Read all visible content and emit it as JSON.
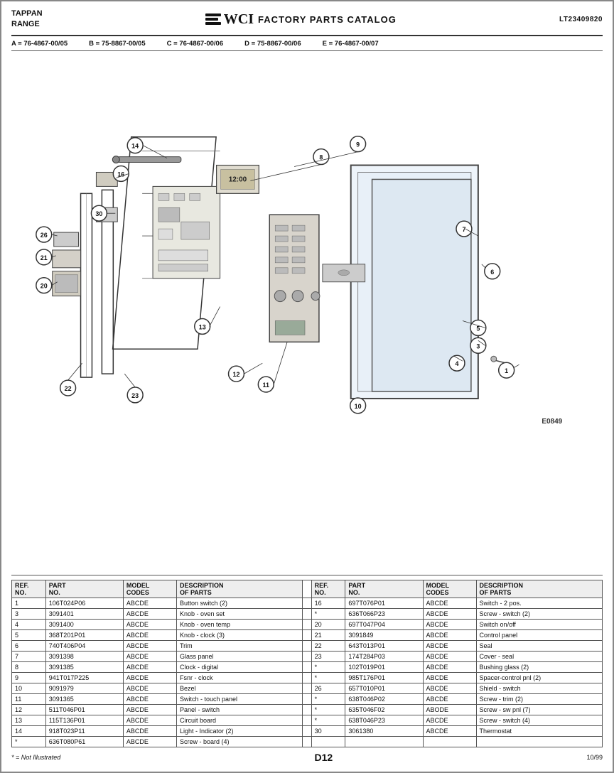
{
  "header": {
    "brand": "TAPPAN\nRANGE",
    "catalog": "FACTORY PARTS CATALOG",
    "catalog_number": "LT23409820"
  },
  "model_codes": [
    "A = 76-4867-00/05",
    "B = 75-8867-00/05",
    "C = 76-4867-00/06",
    "D = 75-8867-00/06",
    "E = 76-4867-00/07"
  ],
  "diagram_id": "E0849",
  "parts_left": [
    {
      "ref": "1",
      "part": "106T024P06",
      "model": "ABCDE",
      "desc": "Button switch (2)"
    },
    {
      "ref": "3",
      "part": "3091401",
      "model": "ABCDE",
      "desc": "Knob - oven set"
    },
    {
      "ref": "4",
      "part": "3091400",
      "model": "ABCDE",
      "desc": "Knob - oven temp"
    },
    {
      "ref": "5",
      "part": "368T201P01",
      "model": "ABCDE",
      "desc": "Knob - clock (3)"
    },
    {
      "ref": "6",
      "part": "740T406P04",
      "model": "ABCDE",
      "desc": "Trim"
    },
    {
      "ref": "7",
      "part": "3091398",
      "model": "ABCDE",
      "desc": "Glass panel"
    },
    {
      "ref": "8",
      "part": "3091385",
      "model": "ABCDE",
      "desc": "Clock - digital"
    },
    {
      "ref": "9",
      "part": "941T017P225",
      "model": "ABCDE",
      "desc": "Fsnr - clock"
    },
    {
      "ref": "10",
      "part": "9091979",
      "model": "ABCDE",
      "desc": "Bezel"
    },
    {
      "ref": "11",
      "part": "3091365",
      "model": "ABCDE",
      "desc": "Switch - touch panel"
    },
    {
      "ref": "12",
      "part": "511T046P01",
      "model": "ABCDE",
      "desc": "Panel - switch"
    },
    {
      "ref": "13",
      "part": "115T136P01",
      "model": "ABCDE",
      "desc": "Circuit board"
    },
    {
      "ref": "14",
      "part": "918T023P11",
      "model": "ABCDE",
      "desc": "Light - Indicator (2)"
    },
    {
      "ref": "*",
      "part": "636T080P61",
      "model": "ABCDE",
      "desc": "Screw - board (4)"
    }
  ],
  "parts_right": [
    {
      "ref": "16",
      "part": "697T076P01",
      "model": "ABCDE",
      "desc": "Switch - 2 pos."
    },
    {
      "ref": "*",
      "part": "636T066P23",
      "model": "ABCDE",
      "desc": "Screw - switch (2)"
    },
    {
      "ref": "20",
      "part": "697T047P04",
      "model": "ABCDE",
      "desc": "Switch on/off"
    },
    {
      "ref": "21",
      "part": "3091849",
      "model": "ABCDE",
      "desc": "Control panel"
    },
    {
      "ref": "22",
      "part": "643T013P01",
      "model": "ABCDE",
      "desc": "Seal"
    },
    {
      "ref": "23",
      "part": "174T284P03",
      "model": "ABCDE",
      "desc": "Cover - seal"
    },
    {
      "ref": "*",
      "part": "102T019P01",
      "model": "ABCDE",
      "desc": "Bushing glass (2)"
    },
    {
      "ref": "*",
      "part": "985T176P01",
      "model": "ABCDE",
      "desc": "Spacer-control pnl (2)"
    },
    {
      "ref": "26",
      "part": "657T010P01",
      "model": "ABCDE",
      "desc": "Shield - switch"
    },
    {
      "ref": "*",
      "part": "638T046P02",
      "model": "ABCDE",
      "desc": "Screw - trim (2)"
    },
    {
      "ref": "*",
      "part": "635T046F02",
      "model": "ABODE",
      "desc": "Screw - sw pnl (7)"
    },
    {
      "ref": "*",
      "part": "638T046P23",
      "model": "ABCDE",
      "desc": "Screw - switch (4)"
    },
    {
      "ref": "30",
      "part": "3061380",
      "model": "ABCDE",
      "desc": "Thermostat"
    }
  ],
  "footer": {
    "note": "* = Not Illustrated",
    "page": "D12",
    "date": "10/99"
  },
  "callouts": [
    1,
    3,
    4,
    5,
    6,
    7,
    8,
    9,
    10,
    11,
    12,
    13,
    14,
    16,
    20,
    21,
    22,
    23,
    26,
    30
  ]
}
